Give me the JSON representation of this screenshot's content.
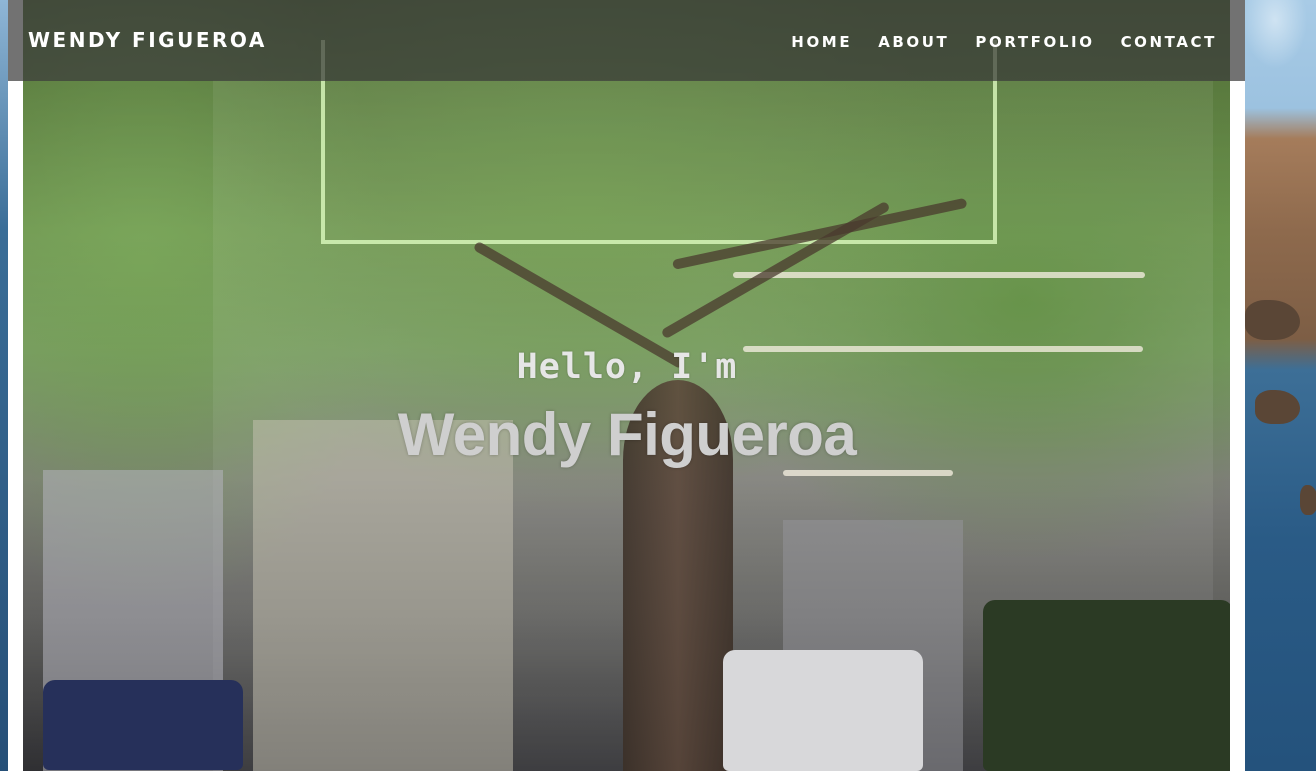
{
  "site": {
    "brand": "WENDY FIGUEROA"
  },
  "nav": {
    "items": [
      {
        "label": "HOME"
      },
      {
        "label": "ABOUT"
      },
      {
        "label": "PORTFOLIO"
      },
      {
        "label": "CONTACT"
      }
    ]
  },
  "hero": {
    "greeting": "Hello, I'm",
    "name": "Wendy Figueroa"
  },
  "colors": {
    "navbar_bg": "#3c3c3c",
    "nav_text": "#ffffff",
    "hero_name_text": "#cfcfcf"
  }
}
